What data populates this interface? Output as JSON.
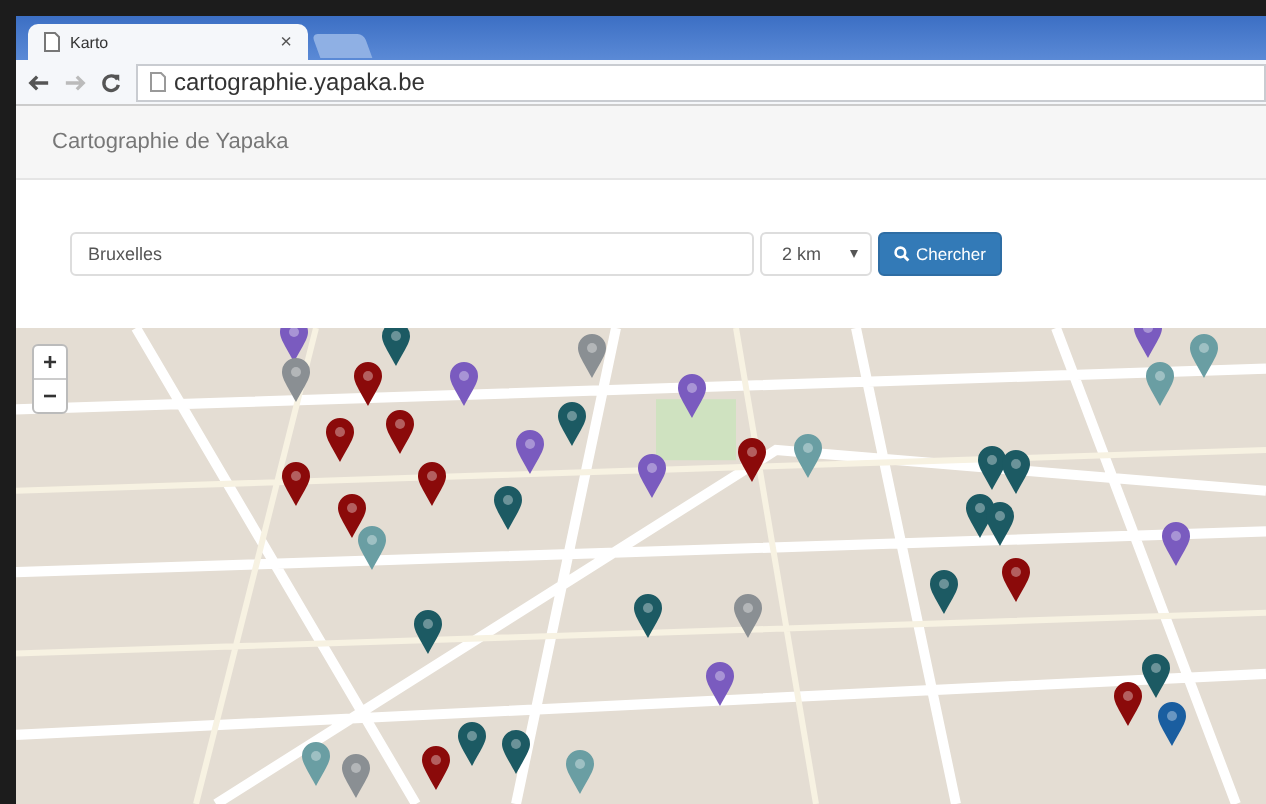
{
  "browser": {
    "tab_title": "Karto",
    "tab_close": "×",
    "url": "cartographie.yapaka.be"
  },
  "navbar": {
    "brand": "Cartographie de Yapaka"
  },
  "search": {
    "value": "Bruxelles",
    "radius": "2 km",
    "button": "Chercher"
  },
  "map": {
    "zoom_in": "+",
    "zoom_out": "−"
  }
}
